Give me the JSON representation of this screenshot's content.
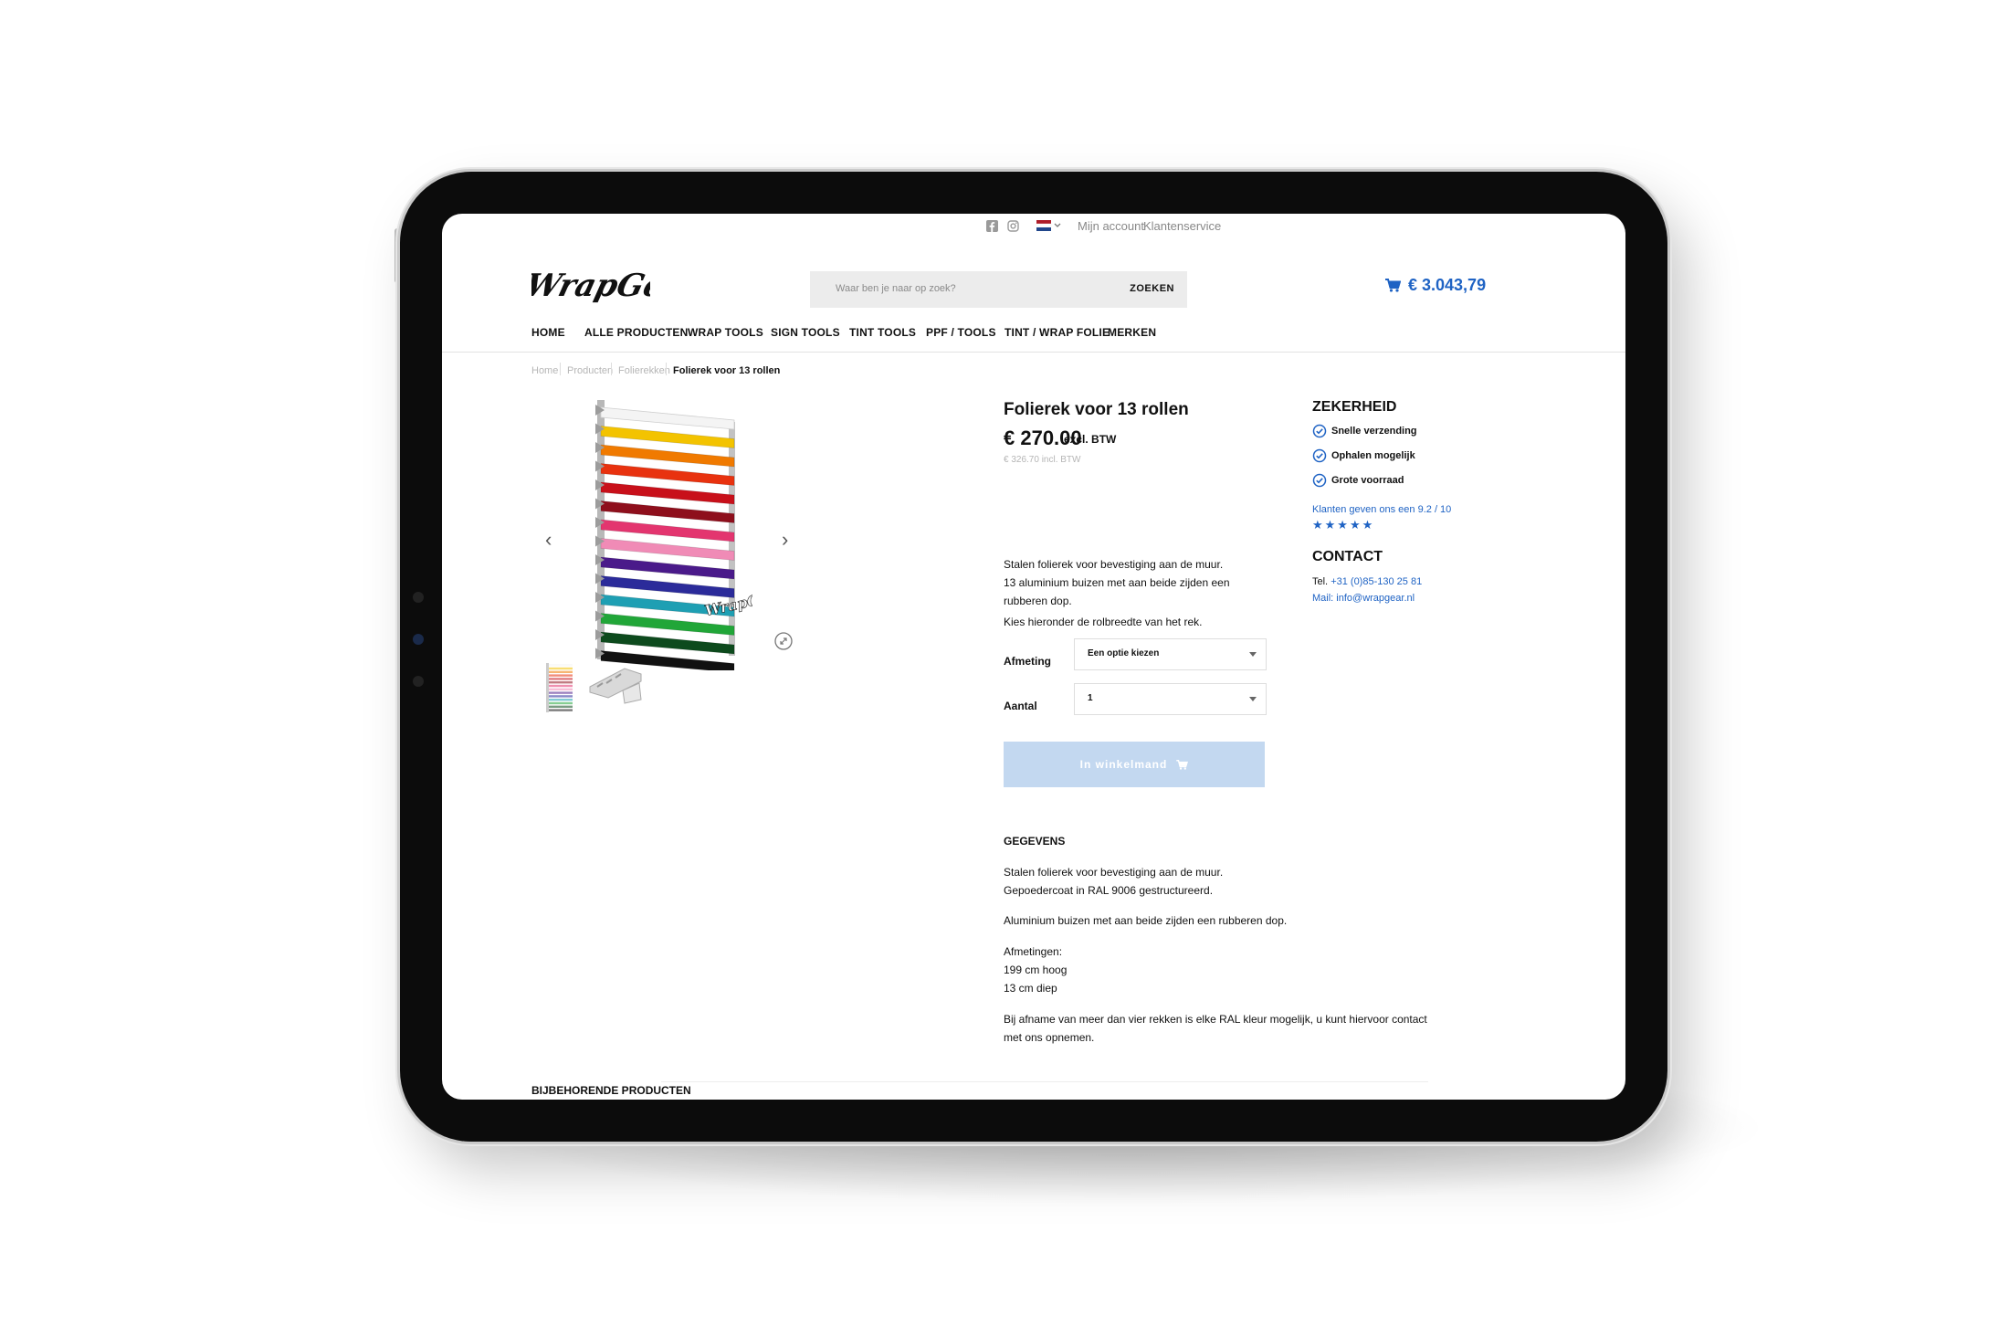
{
  "topbar": {
    "mijn_account": "Mijn account",
    "klantenservice": "Klantenservice"
  },
  "header": {
    "logo_text": "WrapGear",
    "search_placeholder": "Waar ben je naar op zoek?",
    "search_button": "ZOEKEN",
    "cart_total": "€ 3.043,79"
  },
  "nav": [
    "HOME",
    "ALLE PRODUCTEN",
    "WRAP TOOLS",
    "SIGN TOOLS",
    "TINT TOOLS",
    "PPF / TOOLS",
    "TINT / WRAP FOLIE",
    "MERKEN"
  ],
  "breadcrumb": [
    "Home",
    "Producten",
    "Folierekken",
    "Folierek voor 13 rollen"
  ],
  "product": {
    "title": "Folierek voor 13 rollen",
    "price": "€ 270.00",
    "price_suffix": "excl. BTW",
    "price_incl": "€ 326.70 incl. BTW",
    "desc_lines": [
      "Stalen folierek voor bevestiging aan de muur.",
      "13 aluminium buizen met aan beide zijden een",
      "rubberen dop."
    ],
    "choose_text": "Kies hieronder de rolbreedte van het rek.",
    "size_label": "Afmeting",
    "size_value": "Een optie kiezen",
    "qty_label": "Aantal",
    "qty_value": "1",
    "add_to_cart": "In winkelmand"
  },
  "details": {
    "title": "GEGEVENS",
    "p1": [
      "Stalen folierek voor bevestiging aan de muur.",
      "Gepoedercoat in RAL 9006 gestructureerd."
    ],
    "p2": "Aluminium buizen met aan beide zijden een rubberen dop.",
    "p3": [
      "Afmetingen:",
      "199 cm hoog",
      "13 cm diep"
    ],
    "p4": [
      "Bij afname van meer dan vier rekken is elke RAL kleur mogelijk, u kunt hiervoor contact",
      "met ons opnemen."
    ]
  },
  "zekerheid": {
    "title": "ZEKERHEID",
    "items": [
      "Snelle verzending",
      "Ophalen mogelijk",
      "Grote voorraad"
    ],
    "rating_text": "Klanten geven ons een 9.2 / 10",
    "stars": "★★★★★"
  },
  "contact": {
    "title": "CONTACT",
    "tel_label": "Tel.",
    "tel": "+31 (0)85-130 25 81",
    "mail_label": "Mail:",
    "mail": "info@wrapgear.nl"
  },
  "related_title": "BIJBEHORENDE PRODUCTEN",
  "roll_colors": [
    "#f4f4f4",
    "#f3c300",
    "#f07a00",
    "#e8320f",
    "#c8101a",
    "#8e0f1c",
    "#e3356f",
    "#f08bb6",
    "#4a1a8a",
    "#2b2b9a",
    "#1e9fb3",
    "#21a638",
    "#0d4a1d",
    "#111111"
  ],
  "colors": {
    "accent": "#1f63c4",
    "button_disabled": "#c3d8f0"
  }
}
